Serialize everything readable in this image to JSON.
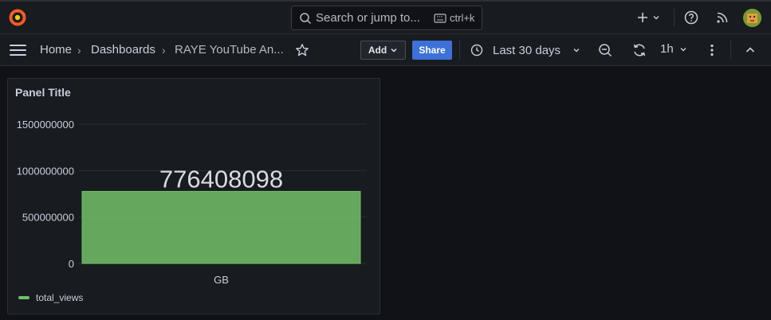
{
  "topbar": {
    "search_placeholder": "Search or jump to...",
    "search_shortcut": "ctrl+k"
  },
  "nav": {
    "breadcrumb": [
      "Home",
      "Dashboards",
      "RAYE YouTube An..."
    ],
    "add_label": "Add",
    "share_label": "Share",
    "time_range": "Last 30 days",
    "refresh_interval": "1h"
  },
  "colors": {
    "accent": "#3d71d9",
    "series": "#73bf69",
    "logo": "#f05a28"
  },
  "panel": {
    "title": "Panel Title",
    "chart_data": {
      "type": "bar",
      "categories": [
        "GB"
      ],
      "series": [
        {
          "name": "total_views",
          "values": [
            776408098
          ]
        }
      ],
      "value_label": "776408098",
      "yticks": [
        "0",
        "500000000",
        "1000000000",
        "1500000000"
      ],
      "ylim": [
        0,
        1500000000
      ],
      "grid": true,
      "legend": "bottom-left"
    }
  }
}
